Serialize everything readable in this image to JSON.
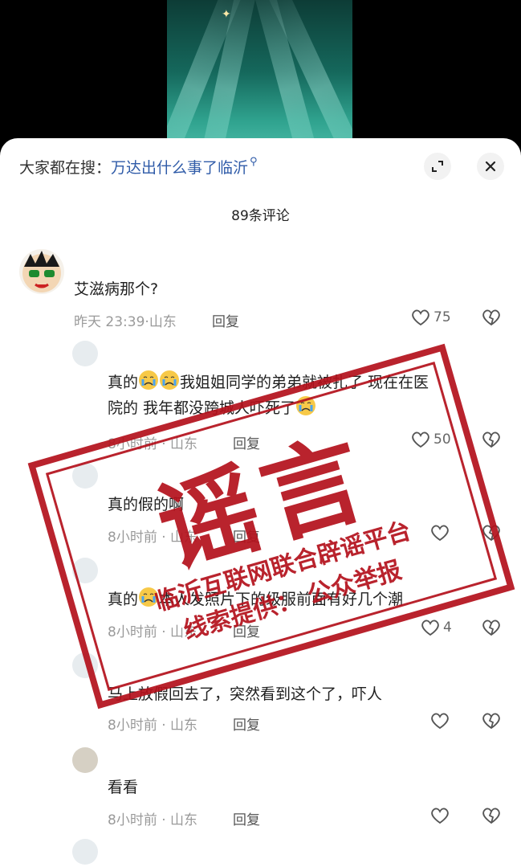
{
  "search": {
    "prefix": "大家都在搜：",
    "query": "万达出什么事了临沂"
  },
  "header": {
    "count": "89条评论"
  },
  "comments": [
    {
      "text": "艾滋病那个?",
      "time": "昨天 23:39",
      "location": "山东",
      "reply": "回复",
      "likes": "75"
    },
    {
      "text_a": "真的",
      "text_b": "我姐姐同学的弟弟就被扎了 现在在医",
      "text_c": "院的 我年都没跨城人吓死了",
      "time": "8小时前",
      "location": "山东",
      "reply": "回复",
      "likes": "50"
    },
    {
      "text": "真的假的啊",
      "time": "8小时前",
      "location": "山东",
      "reply": "回复",
      "likes": ""
    },
    {
      "text_a": "真的",
      "text_b": "本人发照片下的级服前面有好几个潮",
      "time": "8小时前",
      "location": "山东",
      "reply": "回复",
      "likes": "4"
    },
    {
      "text": "马上放假回去了，突然看到这个了，吓人",
      "time": "8小时前",
      "location": "山东",
      "reply": "回复",
      "likes": ""
    },
    {
      "text": "看看",
      "time": "8小时前",
      "location": "山东",
      "reply": "回复",
      "likes": ""
    }
  ],
  "stamp": {
    "title": "谣言",
    "line1": "临沂互联网联合辟谣平台",
    "line2": "线索提供：  公众举报"
  },
  "colors": {
    "stamp": "#b4111c",
    "link": "#2f5ba8"
  }
}
